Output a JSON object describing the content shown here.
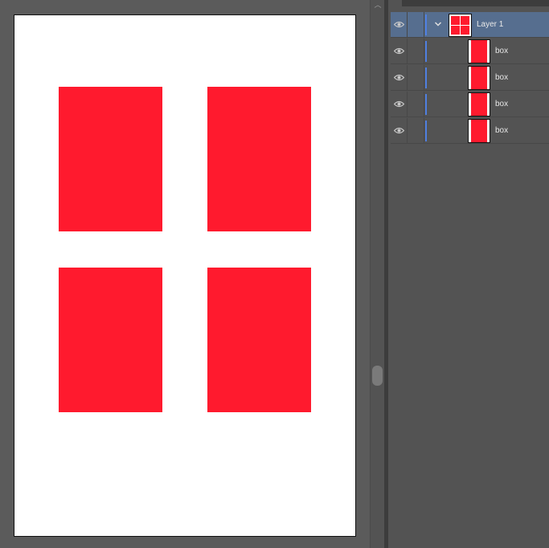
{
  "document": {
    "artboard_color": "#ffffff",
    "shapes": [
      {
        "name": "box",
        "color": "#ff1a2e"
      },
      {
        "name": "box",
        "color": "#ff1a2e"
      },
      {
        "name": "box",
        "color": "#ff1a2e"
      },
      {
        "name": "box",
        "color": "#ff1a2e"
      }
    ]
  },
  "scrollbar": {
    "up_glyph": "︿"
  },
  "layers_panel": {
    "accent_color": "#4f7fe0",
    "selected_row_color": "#566e8f",
    "parent": {
      "label": "Layer 1",
      "expanded": true,
      "icon": "chevron-down-icon",
      "visibility_icon": "eye-icon"
    },
    "children": [
      {
        "label": "box",
        "visibility_icon": "eye-icon"
      },
      {
        "label": "box",
        "visibility_icon": "eye-icon"
      },
      {
        "label": "box",
        "visibility_icon": "eye-icon"
      },
      {
        "label": "box",
        "visibility_icon": "eye-icon"
      }
    ]
  }
}
